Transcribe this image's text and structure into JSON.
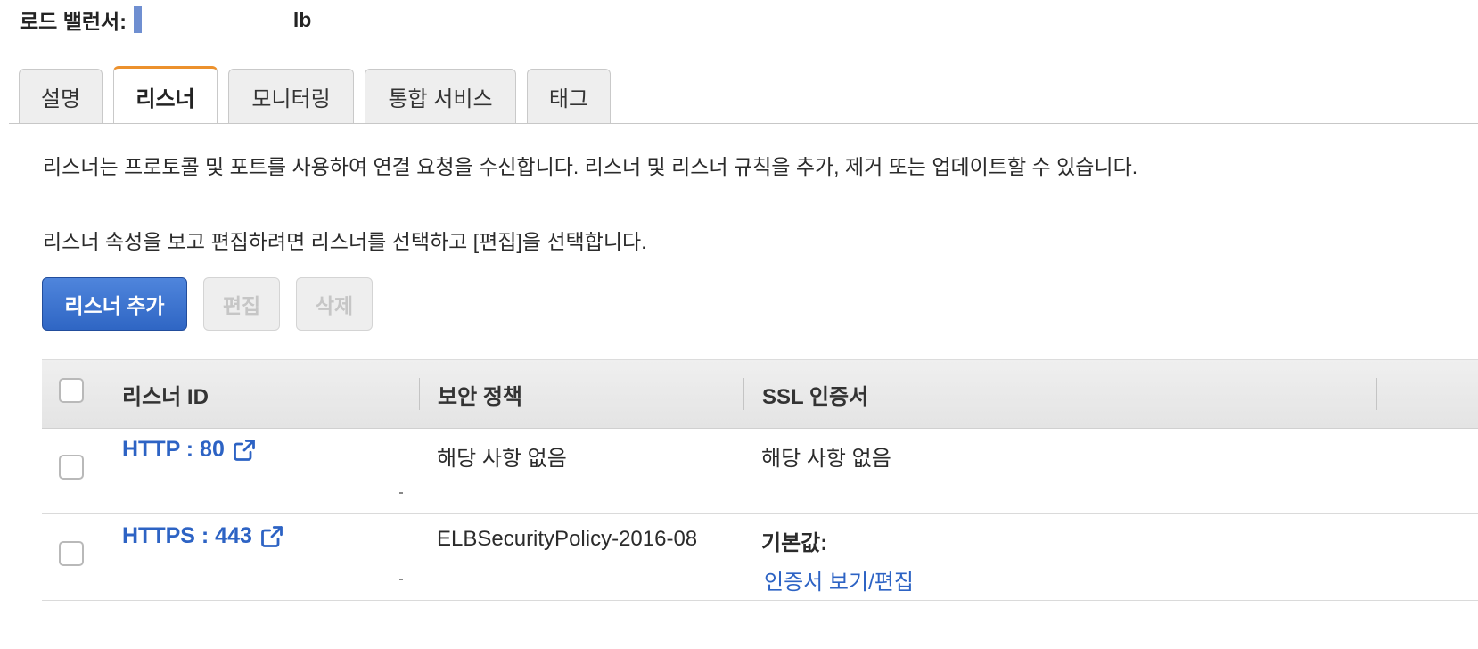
{
  "header": {
    "title_label": "로드 밸런서:",
    "title_suffix": "lb"
  },
  "tabs": [
    {
      "label": "설명",
      "active": false
    },
    {
      "label": "리스너",
      "active": true
    },
    {
      "label": "모니터링",
      "active": false
    },
    {
      "label": "통합 서비스",
      "active": false
    },
    {
      "label": "태그",
      "active": false
    }
  ],
  "description": {
    "line1": "리스너는 프로토콜 및 포트를 사용하여 연결 요청을 수신합니다. 리스너 및 리스너 규칙을 추가, 제거 또는 업데이트할 수 있습니다.",
    "line2": "리스너 속성을 보고 편집하려면 리스너를 선택하고 [편집]을 선택합니다."
  },
  "toolbar": {
    "add_label": "리스너 추가",
    "edit_label": "편집",
    "delete_label": "삭제"
  },
  "table": {
    "columns": [
      "리스너 ID",
      "보안 정책",
      "SSL 인증서"
    ],
    "rows": [
      {
        "listener_id": "HTTP : 80",
        "security_policy": "해당 사항 없음",
        "ssl_certificate": "해당 사항 없음",
        "ssl_link": ""
      },
      {
        "listener_id": "HTTPS : 443",
        "security_policy": "ELBSecurityPolicy-2016-08",
        "ssl_certificate": "기본값:",
        "ssl_link": "인증서 보기/편집"
      }
    ]
  },
  "colors": {
    "accent_tab": "#ec912d",
    "primary_button": "#2f66c4",
    "link": "#2d63c4"
  }
}
